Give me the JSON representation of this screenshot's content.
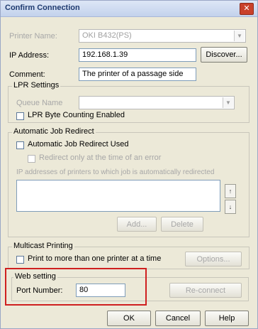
{
  "window": {
    "title": "Confirm Connection",
    "close_glyph": "✕"
  },
  "printer": {
    "name_label": "Printer Name:",
    "name_value": "OKI B432(PS)"
  },
  "ip": {
    "label": "IP Address:",
    "value": "192.168.1.39",
    "discover_button": "Discover..."
  },
  "comment": {
    "label": "Comment:",
    "value": "The printer of a passage side"
  },
  "lpr": {
    "group_label": "LPR Settings",
    "queue_label": "Queue Name",
    "queue_value": "",
    "byte_counting_label": "LPR Byte Counting Enabled",
    "byte_counting_checked": false
  },
  "redirect": {
    "group_label": "Automatic Job Redirect",
    "used_label": "Automatic Job Redirect Used",
    "used_checked": false,
    "error_only_label": "Redirect only at the time of an error",
    "error_only_checked": false,
    "list_label": "IP addresses of printers to which job is automatically redirected",
    "up_arrow": "↑",
    "down_arrow": "↓",
    "add_button": "Add...",
    "delete_button": "Delete"
  },
  "multicast": {
    "group_label": "Multicast Printing",
    "print_more_label": "Print to more than one printer at a time",
    "print_more_checked": false,
    "options_button": "Options..."
  },
  "web": {
    "group_label": "Web setting",
    "port_label": "Port Number:",
    "port_value": "80",
    "reconnect_button": "Re-connect"
  },
  "footer": {
    "ok": "OK",
    "cancel": "Cancel",
    "help": "Help"
  },
  "colors": {
    "highlight": "#cf2020",
    "dialog_bg": "#ece9d8"
  },
  "icons": {
    "close": "close-icon",
    "dropdown": "chevron-down-icon"
  }
}
